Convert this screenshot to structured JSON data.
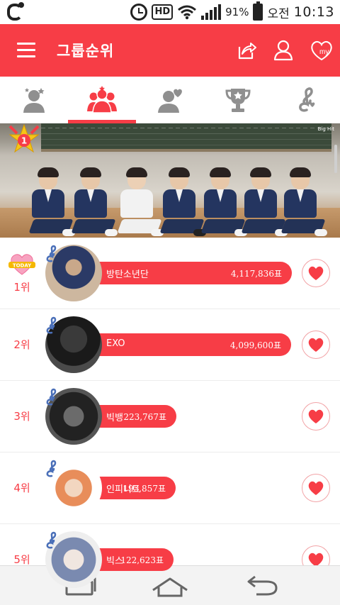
{
  "status_bar": {
    "battery": "91%",
    "ampm": "오전",
    "time": "10:13",
    "hd": "HD",
    "icons": [
      "carrier-logo-icon",
      "alarm-icon",
      "hd-icon",
      "wifi-icon",
      "signal-icon",
      "battery-icon"
    ]
  },
  "appbar": {
    "title": "그룹순위",
    "actions": [
      "share-icon",
      "profile-icon",
      "my-heart-icon"
    ],
    "my_label": "my"
  },
  "tabs": [
    {
      "icon": "idol-person-icon",
      "active": false
    },
    {
      "icon": "group-icon",
      "active": true
    },
    {
      "icon": "person-heart-icon",
      "active": false
    },
    {
      "icon": "trophy-icon",
      "active": false
    },
    {
      "icon": "music-note-icon",
      "active": false
    }
  ],
  "banner": {
    "rank_medal": "1",
    "logo": "Big Hit"
  },
  "today_badge": "TODAY",
  "rankings": [
    {
      "rank": "1위",
      "name": "방탄소년단",
      "votes": "4,117,836표",
      "share": 1.0
    },
    {
      "rank": "2위",
      "name": "EXO",
      "votes": "4,099,600표",
      "share": 0.9956
    },
    {
      "rank": "3위",
      "name": "빅뱅",
      "votes": "223,767표",
      "share": 0.0543
    },
    {
      "rank": "4위",
      "name": "인피니트",
      "votes": "193,857표",
      "share": 0.0471
    },
    {
      "rank": "5위",
      "name": "빅스",
      "votes": "122,623표",
      "share": 0.0298
    }
  ],
  "colors": {
    "accent": "#f73d46",
    "tab_icon": "#8f8f8f"
  },
  "navbar": [
    "recent-apps-icon",
    "home-icon",
    "back-icon"
  ]
}
